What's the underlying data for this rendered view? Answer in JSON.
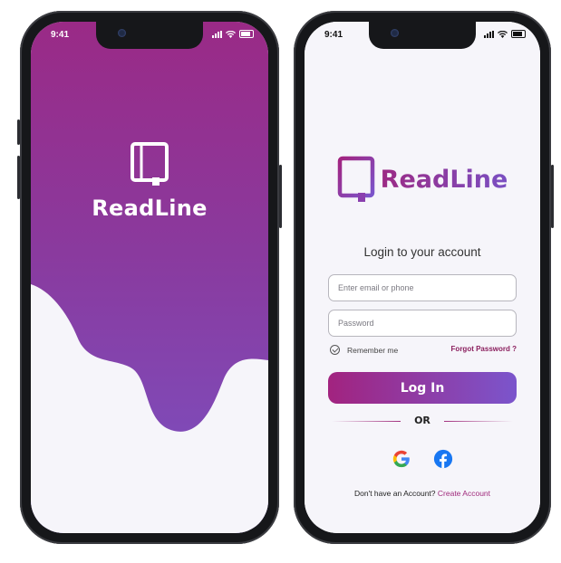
{
  "status_bar": {
    "time": "9:41"
  },
  "splash": {
    "app_name": "ReadLine",
    "colors": {
      "gradient_top": "#9a2a86",
      "gradient_bottom": "#7a52c4",
      "background": "#f6f5fa"
    },
    "logo_icon": "book-icon"
  },
  "login": {
    "app_name": "ReadLine",
    "heading": "Login to your account",
    "email_placeholder": "Enter email or phone",
    "password_placeholder": "Password",
    "remember_me": "Remember me",
    "forgot_password": "Forgot Password ?",
    "login_button": "Log In",
    "or_text": "OR",
    "social": [
      "google-icon",
      "facebook-icon"
    ],
    "signup_prompt": "Don't have an Account?",
    "create_account": "Create Account",
    "colors": {
      "accent_start": "#a2237f",
      "accent_end": "#7b55cc",
      "link": "#a02a7c"
    }
  }
}
